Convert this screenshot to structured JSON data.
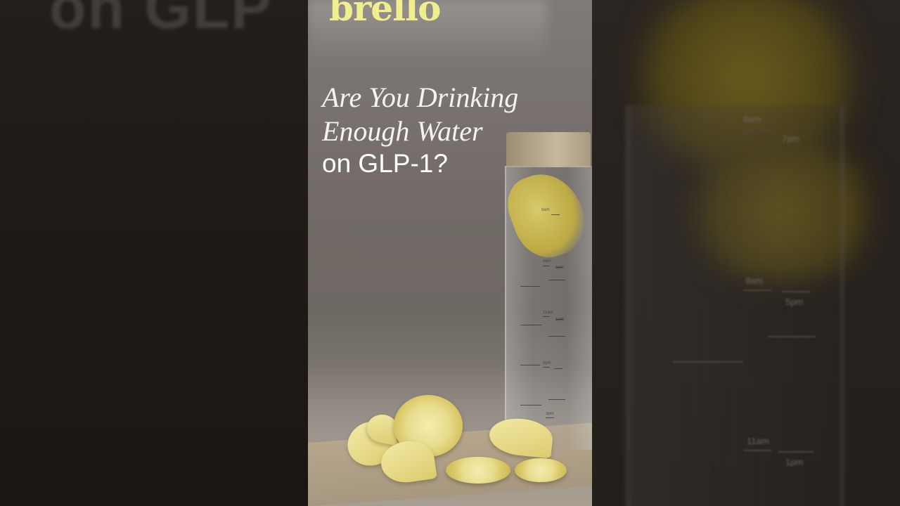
{
  "logo": {
    "text": "brello",
    "color": "#f1ee8e"
  },
  "headline": {
    "line1": "Are You Drinking",
    "line2": "Enough Water",
    "line3": "on GLP-1?"
  },
  "bottle_markings": [
    "8am",
    "9am",
    "11am",
    "1pm",
    "2pm",
    "3pm",
    "5pm",
    "7pm"
  ],
  "side_ghost_text": "on GLP",
  "colors": {
    "background": "#1b1714",
    "headline": "#ffffff",
    "logo": "#f1ee8e"
  }
}
